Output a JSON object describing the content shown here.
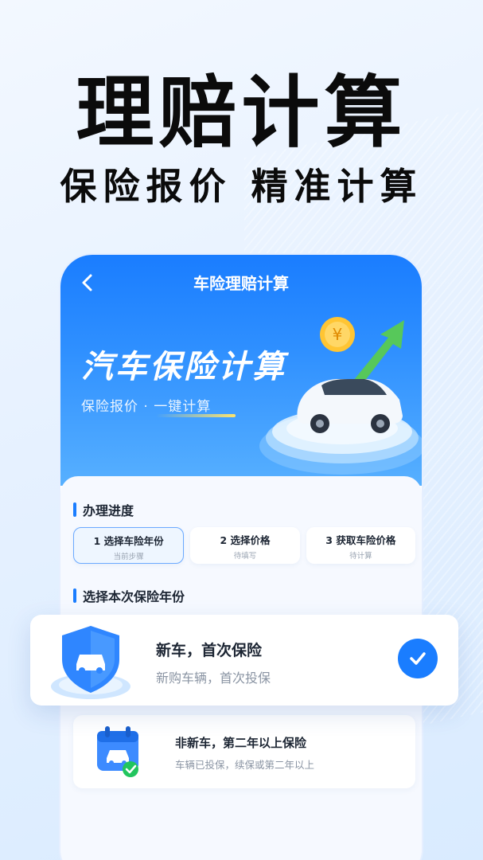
{
  "hero": {
    "title": "理赔计算",
    "subtitle": "保险报价 精准计算"
  },
  "screen": {
    "nav_title": "车险理赔计算",
    "banner": {
      "title": "汽车保险计算",
      "subtitle": "保险报价 · 一键计算"
    },
    "progress": {
      "heading": "办理进度",
      "steps": [
        {
          "label": "1 选择车险年份",
          "status": "当前步骤"
        },
        {
          "label": "2 选择价格",
          "status": "待填写"
        },
        {
          "label": "3 获取车险价格",
          "status": "待计算"
        }
      ]
    },
    "year_select": {
      "heading": "选择本次保险年份",
      "options": [
        {
          "title": "新车，首次保险",
          "desc": "新购车辆，首次投保",
          "selected": true
        },
        {
          "title": "非新车，第二年以上保险",
          "desc": "车辆已投保，续保或第二年以上",
          "selected": false
        }
      ]
    }
  },
  "icons": [
    "back-icon",
    "car-illustration",
    "shield-car-icon",
    "check-icon",
    "calendar-car-icon"
  ],
  "colors": {
    "primary": "#1a7dff",
    "text": "#1c2533",
    "muted": "#8a94a3"
  }
}
